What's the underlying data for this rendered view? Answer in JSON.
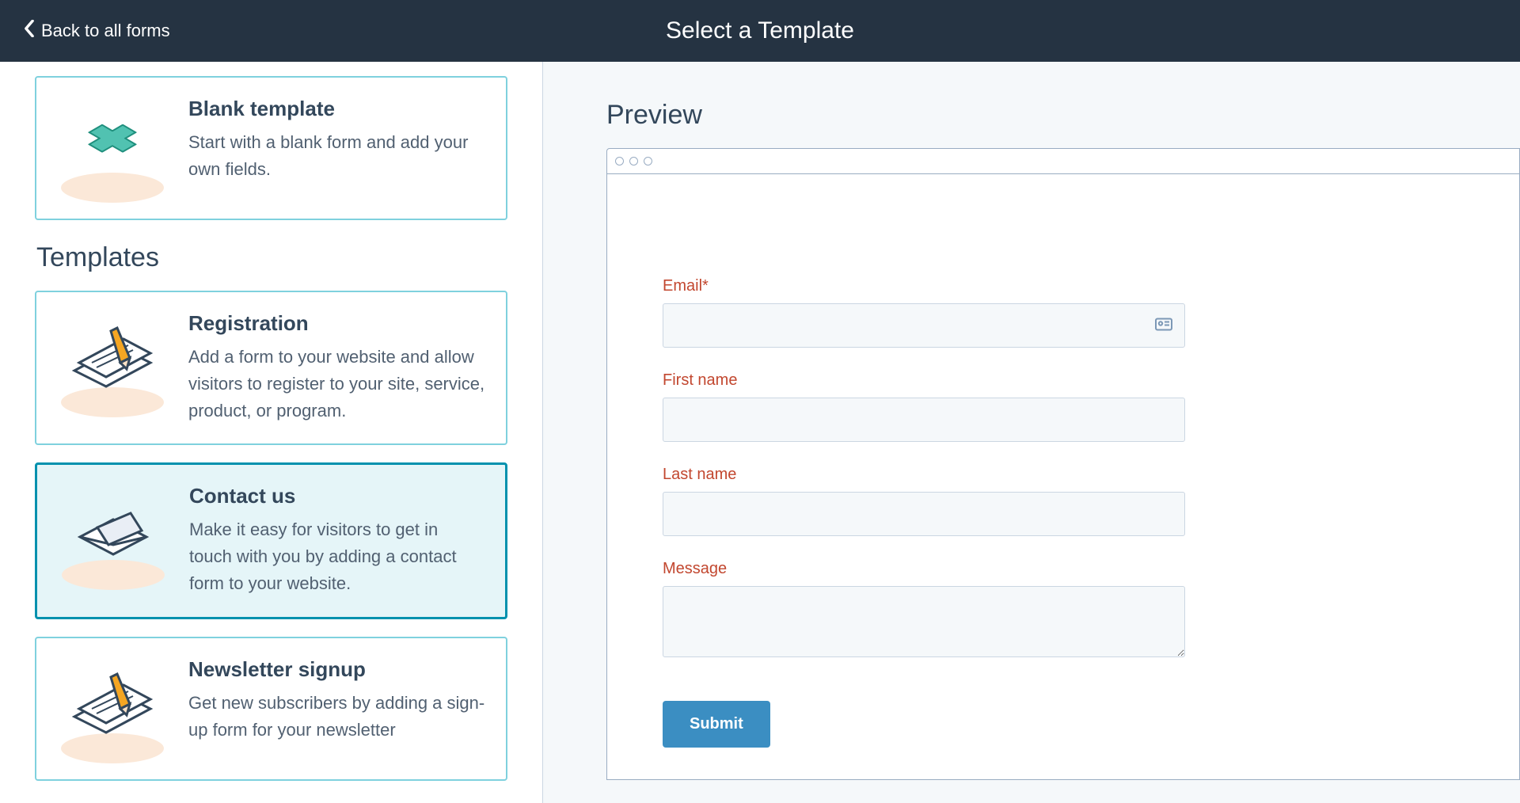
{
  "header": {
    "back_label": "Back to all forms",
    "title": "Select a Template"
  },
  "sidebar": {
    "blank": {
      "title": "Blank template",
      "desc": "Start with a blank form and add your own fields."
    },
    "section_label": "Templates",
    "templates": [
      {
        "title": "Registration",
        "desc": "Add a form to your website and allow visitors to register to your site, service, product, or program."
      },
      {
        "title": "Contact us",
        "desc": "Make it easy for visitors to get in touch with you by adding a contact form to your website."
      },
      {
        "title": "Newsletter signup",
        "desc": "Get new subscribers by adding a sign-up form for your newsletter"
      }
    ]
  },
  "preview": {
    "heading": "Preview",
    "fields": {
      "email_label": "Email*",
      "firstname_label": "First name",
      "lastname_label": "Last name",
      "message_label": "Message"
    },
    "submit_label": "Submit"
  }
}
